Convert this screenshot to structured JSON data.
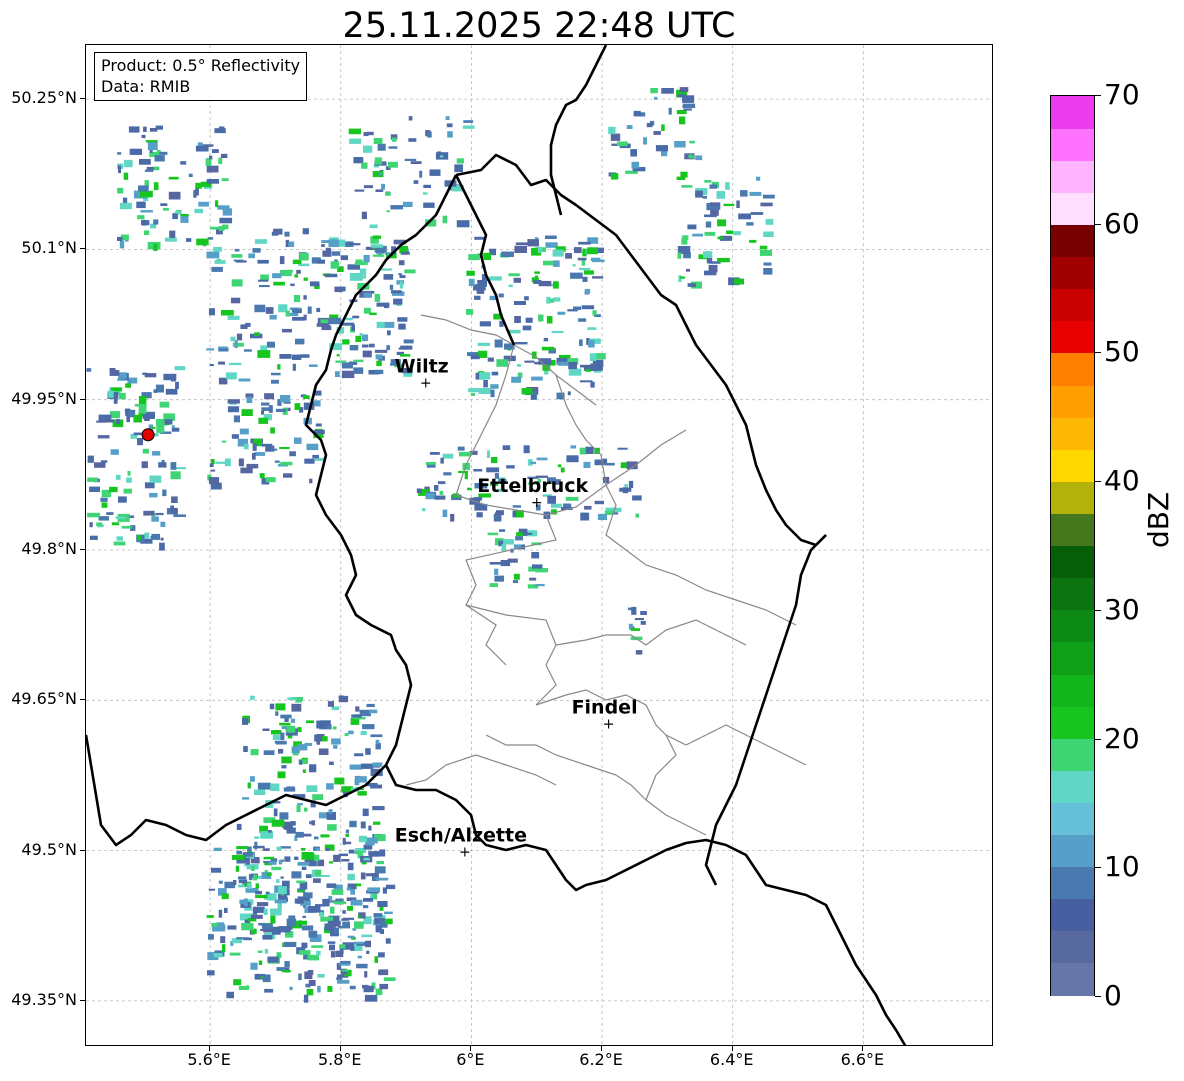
{
  "title": "25.11.2025 22:48 UTC",
  "info": {
    "product": "Product: 0.5° Reflectivity",
    "source": "Data: RMIB"
  },
  "map": {
    "lon_range": [
      5.4,
      6.8
    ],
    "lat_range": [
      49.3,
      50.3
    ],
    "lat_ticks": [
      {
        "value": 50.25,
        "label": "50.25°N"
      },
      {
        "value": 50.1,
        "label": "50.1°N"
      },
      {
        "value": 49.95,
        "label": "49.95°N"
      },
      {
        "value": 49.8,
        "label": "49.8°N"
      },
      {
        "value": 49.65,
        "label": "49.65°N"
      },
      {
        "value": 49.5,
        "label": "49.5°N"
      },
      {
        "value": 49.35,
        "label": "49.35°N"
      }
    ],
    "lon_ticks": [
      {
        "value": 5.6,
        "label": "5.6°E"
      },
      {
        "value": 5.8,
        "label": "5.8°E"
      },
      {
        "value": 6.0,
        "label": "6°E"
      },
      {
        "value": 6.2,
        "label": "6.2°E"
      },
      {
        "value": 6.4,
        "label": "6.4°E"
      },
      {
        "value": 6.6,
        "label": "6.6°E"
      }
    ],
    "cities": [
      {
        "name": "Wiltz",
        "lon": 5.93,
        "lat": 49.967
      },
      {
        "name": "Ettelbruck",
        "lon": 6.1,
        "lat": 49.848
      },
      {
        "name": "Findel",
        "lon": 6.21,
        "lat": 49.627
      },
      {
        "name": "Esch/Alzette",
        "lon": 5.99,
        "lat": 49.499
      }
    ],
    "radar_site": {
      "lon": 5.505,
      "lat": 49.915
    },
    "grid": true
  },
  "colorbar": {
    "label": "dBZ",
    "min": 0,
    "max": 70,
    "ticks": [
      {
        "value": 0,
        "label": "0"
      },
      {
        "value": 10,
        "label": "10"
      },
      {
        "value": 20,
        "label": "20"
      },
      {
        "value": 30,
        "label": "30"
      },
      {
        "value": 40,
        "label": "40"
      },
      {
        "value": 50,
        "label": "50"
      },
      {
        "value": 60,
        "label": "60"
      },
      {
        "value": 70,
        "label": "70"
      }
    ],
    "colors": [
      "#6676a8",
      "#57699e",
      "#475fa0",
      "#4a79b0",
      "#569fc8",
      "#65c0d8",
      "#5fd7c4",
      "#3fd474",
      "#16c51e",
      "#12b51c",
      "#10a018",
      "#0d8a14",
      "#0c7410",
      "#075e08",
      "#45781c",
      "#b1b30b",
      "#ffd800",
      "#fdb705",
      "#ff9e00",
      "#ff7f00",
      "#e60000",
      "#c80000",
      "#a00000",
      "#780000",
      "#ffdfff",
      "#ffb4ff",
      "#ff72ff",
      "#ec3bef"
    ]
  }
}
